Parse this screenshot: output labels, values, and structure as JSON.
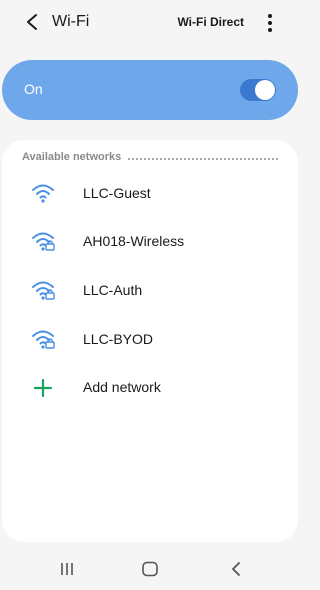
{
  "header": {
    "back_icon": "back-arrow-icon",
    "title": "Wi-Fi",
    "wifi_direct_label": "Wi-Fi Direct",
    "more_icon": "more-vertical-icon"
  },
  "master_toggle": {
    "label": "On",
    "state": "on",
    "card_color": "#6ea8ea",
    "toggle_color": "#3b78d0"
  },
  "available_networks": {
    "header": "Available networks",
    "networks": [
      {
        "name": "LLC-Guest",
        "secured": false,
        "icon": "wifi-icon"
      },
      {
        "name": "AH018-Wireless",
        "secured": true,
        "icon": "wifi-lock-icon"
      },
      {
        "name": "LLC-Auth",
        "secured": true,
        "icon": "wifi-lock-icon"
      },
      {
        "name": "LLC-BYOD",
        "secured": true,
        "icon": "wifi-lock-icon"
      }
    ],
    "add_network": {
      "label": "Add network",
      "icon": "plus-icon",
      "color": "#1aa260"
    },
    "wifi_icon_color": "#4a90e2"
  },
  "nav_bar": {
    "recent_icon": "recent-apps-icon",
    "home_icon": "home-icon",
    "back_icon": "back-icon"
  }
}
